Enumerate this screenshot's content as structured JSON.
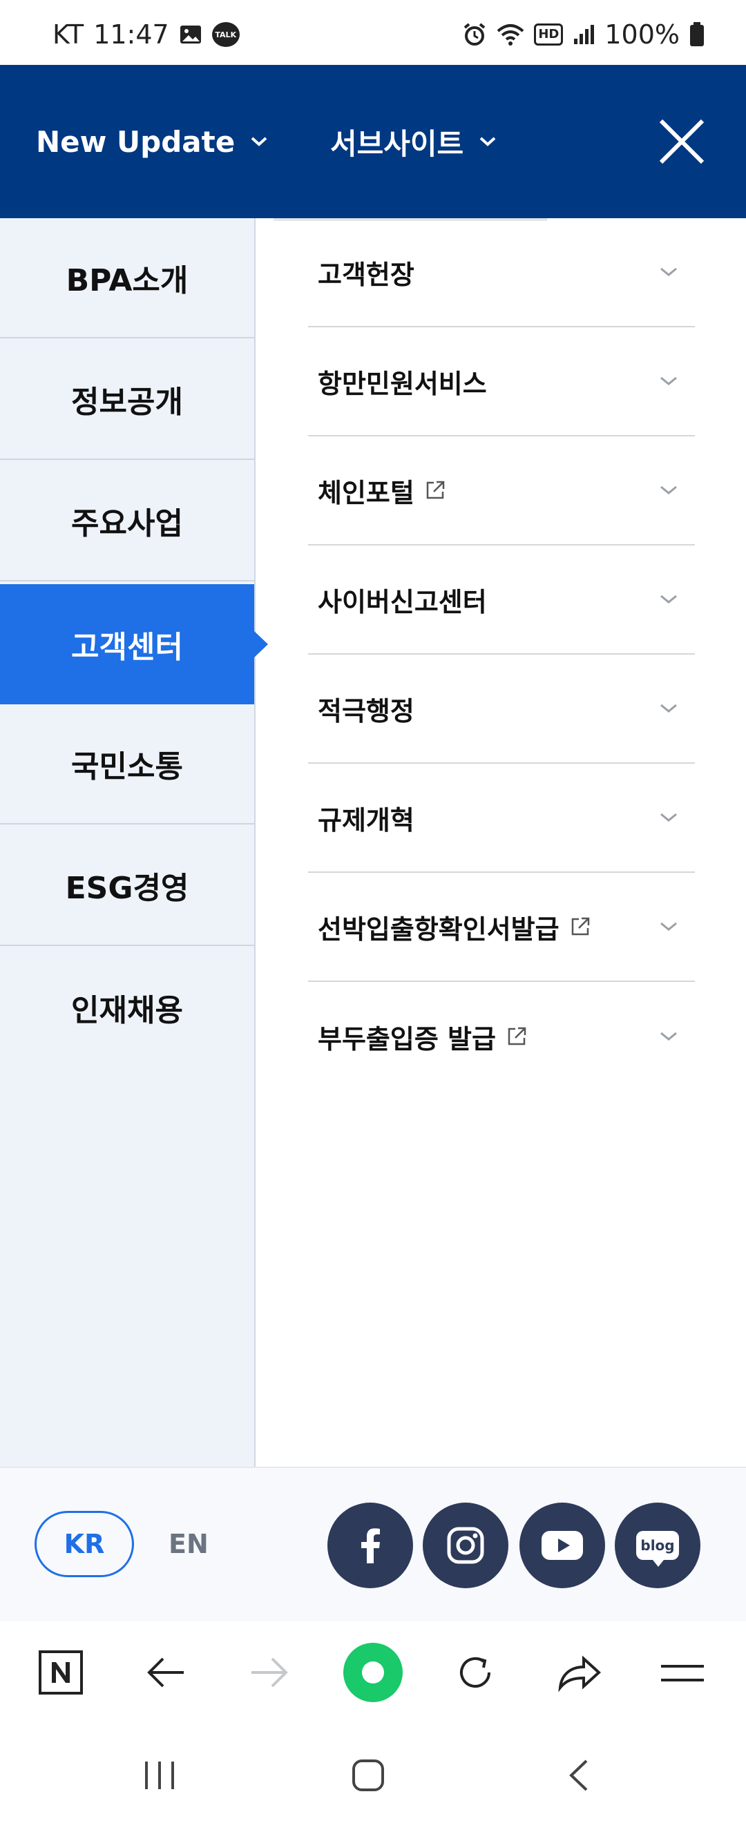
{
  "status_bar": {
    "carrier": "KT",
    "time": "11:47",
    "talk_badge": "TALK",
    "hd_label": "HD",
    "battery": "100%"
  },
  "top_nav": {
    "new_update": "New Update",
    "sub_sites": "서브사이트"
  },
  "sidebar": {
    "items": [
      {
        "label": "BPA소개"
      },
      {
        "label": "정보공개"
      },
      {
        "label": "주요사업"
      },
      {
        "label": "고객센터"
      },
      {
        "label": "국민소통"
      },
      {
        "label": "ESG경영"
      },
      {
        "label": "인재채용"
      }
    ],
    "active_index": 3
  },
  "menu": {
    "items": [
      {
        "label": "고객헌장",
        "external": false
      },
      {
        "label": "항만민원서비스",
        "external": false
      },
      {
        "label": "체인포털",
        "external": true
      },
      {
        "label": "사이버신고센터",
        "external": false
      },
      {
        "label": "적극행정",
        "external": false
      },
      {
        "label": "규제개혁",
        "external": false
      },
      {
        "label": "선박입출항확인서발급",
        "external": true
      },
      {
        "label": "부두출입증 발급",
        "external": true
      }
    ]
  },
  "footer": {
    "lang_kr": "KR",
    "lang_en": "EN",
    "blog_label": "blog",
    "social_icons": [
      "facebook-icon",
      "instagram-icon",
      "youtube-icon",
      "blog-icon"
    ]
  },
  "browser_bar": {
    "icons": [
      "naver-home-icon",
      "back-arrow-icon",
      "forward-arrow-icon",
      "green-dot-icon",
      "refresh-icon",
      "share-icon",
      "menu-icon"
    ]
  },
  "colors": {
    "nav_blue": "#003882",
    "active_blue": "#1f6fe6",
    "sidebar_bg": "#eef3fa",
    "social_bg": "#2d3a59",
    "green": "#19c96a"
  }
}
